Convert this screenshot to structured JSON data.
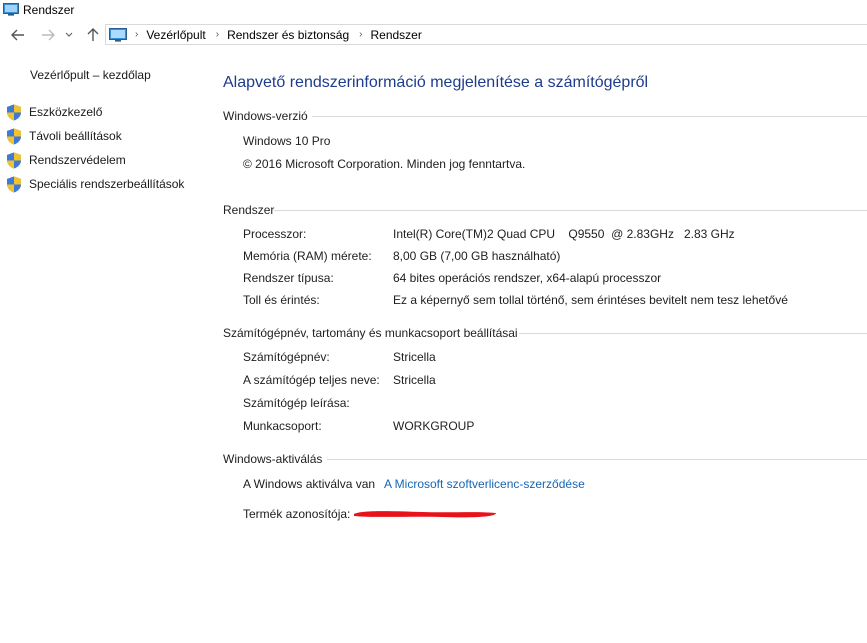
{
  "window": {
    "title": "Rendszer",
    "icon": "monitor-icon"
  },
  "nav": {
    "breadcrumbs": [
      "Vezérlőpult",
      "Rendszer és biztonság",
      "Rendszer"
    ],
    "separator": "›"
  },
  "sidebar": {
    "home": "Vezérlőpult – kezdőlap",
    "items": [
      {
        "label": "Eszközkezelő",
        "icon": "shield-icon"
      },
      {
        "label": "Távoli beállítások",
        "icon": "shield-icon"
      },
      {
        "label": "Rendszervédelem",
        "icon": "shield-icon"
      },
      {
        "label": "Speciális rendszerbeállítások",
        "icon": "shield-icon"
      }
    ]
  },
  "main": {
    "heading": "Alapvető rendszerinformáció megjelenítése a számítógépről",
    "windows_version": {
      "title": "Windows-verzió",
      "edition": "Windows 10 Pro",
      "copyright": "© 2016 Microsoft Corporation. Minden jog fenntartva."
    },
    "system": {
      "title": "Rendszer",
      "rows": [
        {
          "label": "Processzor:",
          "value": "Intel(R) Core(TM)2 Quad CPU    Q9550  @ 2.83GHz   2.83 GHz"
        },
        {
          "label": "Memória (RAM) mérete:",
          "value": "8,00 GB (7,00 GB használható)"
        },
        {
          "label": "Rendszer típusa:",
          "value": "64 bites operációs rendszer, x64-alapú processzor"
        },
        {
          "label": "Toll és érintés:",
          "value": "Ez a képernyő sem tollal történő, sem érintéses bevitelt nem tesz lehetővé"
        }
      ]
    },
    "computer_name": {
      "title": "Számítógépnév, tartomány és munkacsoport beállításai",
      "rows": [
        {
          "label": "Számítógépnév:",
          "value": "Stricella"
        },
        {
          "label": "A számítógép teljes neve:",
          "value": "Stricella"
        },
        {
          "label": "Számítógép leírása:",
          "value": ""
        },
        {
          "label": "Munkacsoport:",
          "value": "WORKGROUP"
        }
      ]
    },
    "activation": {
      "title": "Windows-aktiválás",
      "status": "A Windows aktiválva van",
      "license_link": "A Microsoft szoftverlicenc-szerződése",
      "product_id_label": "Termék azonosítója:",
      "redaction_color": "#e8121a"
    }
  },
  "colors": {
    "heading": "#1e3c8c",
    "link": "#1766b3"
  }
}
